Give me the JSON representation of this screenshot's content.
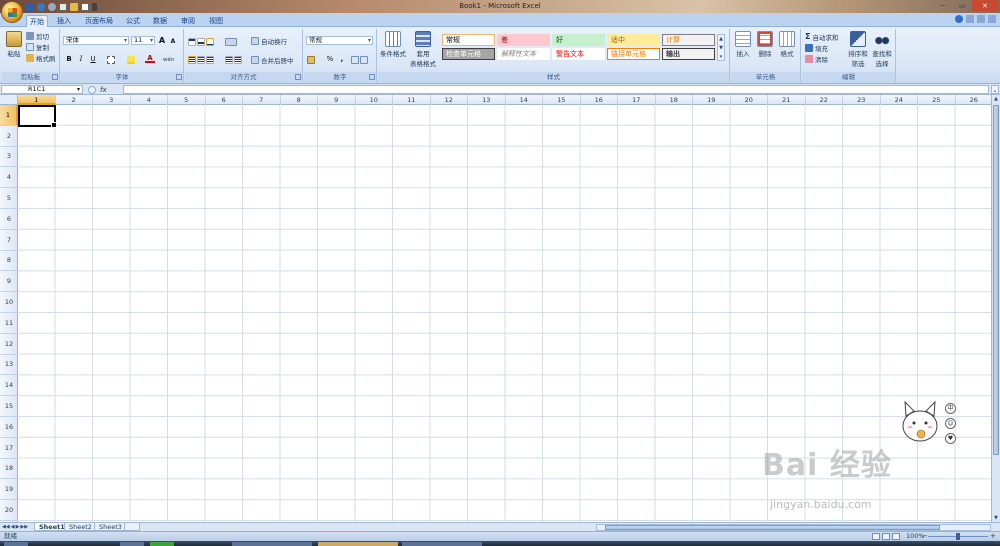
{
  "window": {
    "title": "Book1 - Microsoft Excel"
  },
  "ribbon_tabs": [
    "开始",
    "插入",
    "页面布局",
    "公式",
    "数据",
    "审阅",
    "视图"
  ],
  "clipboard": {
    "paste": "粘贴",
    "cut": "剪切",
    "copy": "复制",
    "format_painter": "格式刷",
    "group_label": "剪贴板"
  },
  "font": {
    "name": "宋体",
    "size": "11",
    "bold": "B",
    "italic": "I",
    "underline": "U",
    "grow": "A",
    "shrink": "A",
    "font_color_letter": "A",
    "phonetic": "wén",
    "group_label": "字体"
  },
  "alignment": {
    "wrap_text": "自动换行",
    "merge_center": "合并后居中",
    "group_label": "对齐方式"
  },
  "number": {
    "format": "常规",
    "percent": "%",
    "comma": ",",
    "group_label": "数字"
  },
  "styles": {
    "conditional_formatting": "条件格式",
    "format_as_table_line1": "套用",
    "format_as_table_line2": "表格格式",
    "cells": [
      {
        "label": "常规",
        "bg": "#ffffff",
        "fg": "#000000",
        "border": "#f0b86a"
      },
      {
        "label": "差",
        "bg": "#ffc7ce",
        "fg": "#9c0006",
        "border": "#ffc7ce"
      },
      {
        "label": "好",
        "bg": "#c6efce",
        "fg": "#006100",
        "border": "#c6efce"
      },
      {
        "label": "适中",
        "bg": "#ffeb9c",
        "fg": "#9c6500",
        "border": "#ffeb9c"
      },
      {
        "label": "计算",
        "bg": "#f2f2f2",
        "fg": "#fa7d00",
        "border": "#7f7f7f"
      },
      {
        "label": "检查单元格",
        "bg": "#a5a5a5",
        "fg": "#ffffff",
        "border": "#3f3f3f"
      },
      {
        "label": "解释性文本",
        "bg": "#ffffff",
        "fg": "#7f7f7f",
        "border": "#ffffff"
      },
      {
        "label": "警告文本",
        "bg": "#ffffff",
        "fg": "#ff0000",
        "border": "#ffffff"
      },
      {
        "label": "链接单元格",
        "bg": "#ffffff",
        "fg": "#fa7d00",
        "border": "#fa7d00"
      },
      {
        "label": "输出",
        "bg": "#f2f2f2",
        "fg": "#3f3f3f",
        "border": "#3f3f3f"
      }
    ],
    "group_label": "样式"
  },
  "cells_group": {
    "insert": "插入",
    "delete": "删除",
    "format": "格式",
    "group_label": "单元格"
  },
  "editing": {
    "autosum": "自动求和",
    "fill": "填充",
    "clear": "清除",
    "sort_filter_line1": "排序和",
    "sort_filter_line2": "筛选",
    "find_select_line1": "查找和",
    "find_select_line2": "选择",
    "group_label": "编辑"
  },
  "formula_bar": {
    "name_box": "R1C1",
    "fx": "fx",
    "value": ""
  },
  "grid": {
    "columns": [
      "1",
      "2",
      "3",
      "4",
      "5",
      "6",
      "7",
      "8",
      "9",
      "10",
      "11",
      "12",
      "13",
      "14",
      "15",
      "16",
      "17",
      "18",
      "19",
      "20",
      "21",
      "22",
      "23",
      "24",
      "25",
      "26"
    ],
    "rows": [
      "1",
      "2",
      "3",
      "4",
      "5",
      "6",
      "7",
      "8",
      "9",
      "10",
      "11",
      "12",
      "13",
      "14",
      "15",
      "16",
      "17",
      "18",
      "19",
      "20"
    ],
    "selected_column": "1",
    "selected_row": "1"
  },
  "sheets": [
    "Sheet1",
    "Sheet2",
    "Sheet3"
  ],
  "status": {
    "ready": "就绪",
    "zoom": "100%"
  },
  "side_icons": [
    "中",
    "☺",
    "♥"
  ],
  "watermark": {
    "brand": "Bai 经验",
    "domain": "jingyan.baidu.com"
  },
  "colors": {
    "ribbon_bg": "#dbe7f6",
    "selected_header": "#f1c15f",
    "accent": "#15428b"
  }
}
